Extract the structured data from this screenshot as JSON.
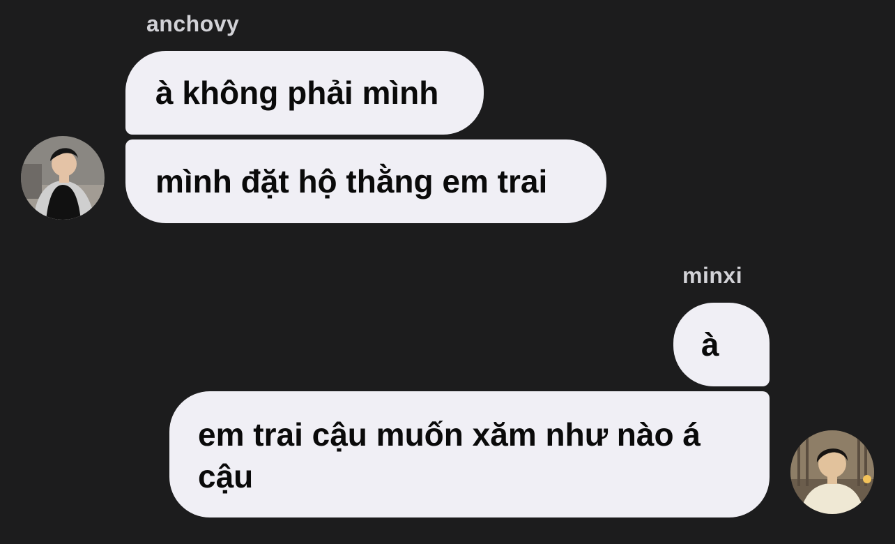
{
  "conversation": {
    "incoming": {
      "sender": "anchovy",
      "messages": [
        "à không phải mình",
        "mình đặt hộ thằng em trai"
      ],
      "avatar_icon": "user-avatar-photo"
    },
    "outgoing": {
      "sender": "minxi",
      "messages": [
        "à",
        "em trai cậu muốn xăm như nào á cậu"
      ],
      "avatar_icon": "user-avatar-photo"
    }
  },
  "colors": {
    "background": "#1c1c1d",
    "bubble": "#f0eff5",
    "bubble_text": "#0a0a0a",
    "name_text": "#d2d2d7"
  }
}
